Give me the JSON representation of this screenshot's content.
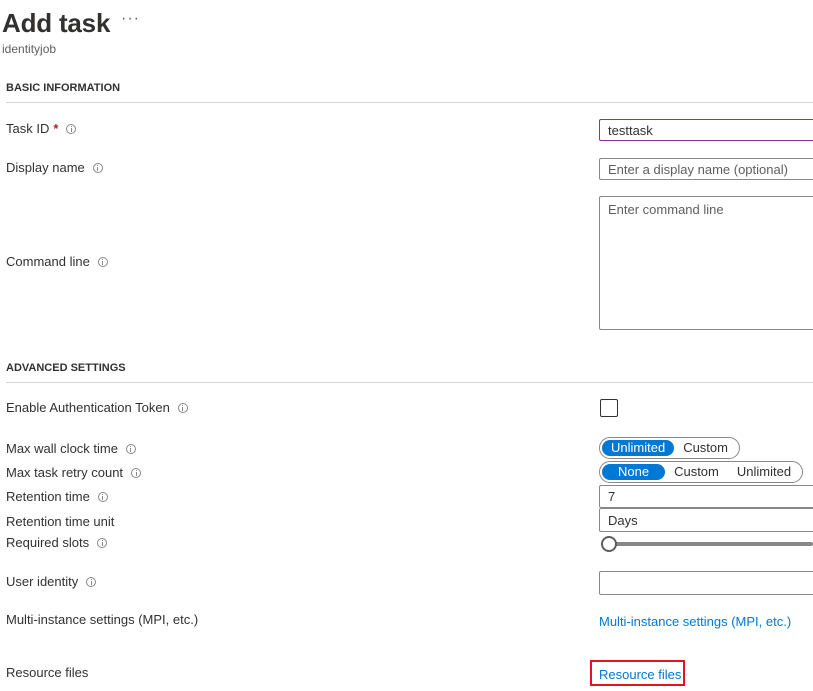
{
  "header": {
    "title": "Add task",
    "more_label": "···",
    "subtitle": "identityjob"
  },
  "sections": {
    "basic": "BASIC INFORMATION",
    "advanced": "ADVANCED SETTINGS"
  },
  "fields": {
    "task_id": {
      "label": "Task ID",
      "required_mark": "*",
      "value": "testtask",
      "placeholder": ""
    },
    "display_name": {
      "label": "Display name",
      "value": "",
      "placeholder": "Enter a display name (optional)"
    },
    "command_line": {
      "label": "Command line",
      "value": "",
      "placeholder": "Enter command line"
    },
    "auth_token": {
      "label": "Enable Authentication Token",
      "checked": false
    },
    "max_wall_clock": {
      "label": "Max wall clock time",
      "options": [
        "Unlimited",
        "Custom"
      ],
      "selected": "Unlimited"
    },
    "max_retry": {
      "label": "Max task retry count",
      "options": [
        "None",
        "Custom",
        "Unlimited"
      ],
      "selected": "None"
    },
    "retention_time": {
      "label": "Retention time",
      "value": "7"
    },
    "retention_unit": {
      "label": "Retention time unit",
      "value": "Days"
    },
    "required_slots": {
      "label": "Required slots",
      "slider_fraction": 0
    },
    "user_identity": {
      "label": "User identity",
      "value": ""
    },
    "multi_instance": {
      "label": "Multi-instance settings (MPI, etc.)",
      "link": "Multi-instance settings (MPI, etc.)"
    },
    "resource_files": {
      "label": "Resource files",
      "link": "Resource files"
    }
  },
  "colors": {
    "accent": "#0078d4",
    "focus_border": "#8c2fa8",
    "required": "#a4262c",
    "highlight": "#e81123"
  }
}
